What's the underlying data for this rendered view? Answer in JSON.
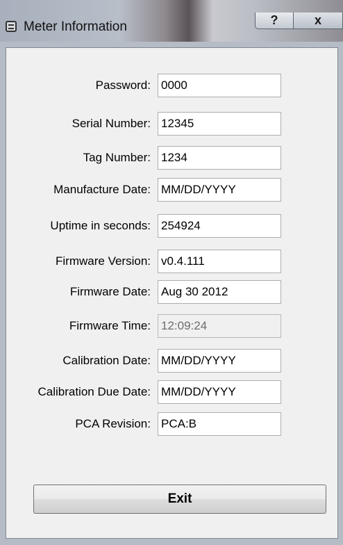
{
  "window": {
    "title": "Meter Information",
    "help_label": "?",
    "close_label": "x"
  },
  "fields": [
    {
      "label": "Password:",
      "value": "0000",
      "enabled": true
    },
    {
      "label": "Serial Number:",
      "value": "12345",
      "enabled": true
    },
    {
      "label": "Tag Number:",
      "value": "1234",
      "enabled": true
    },
    {
      "label": "Manufacture Date:",
      "value": "MM/DD/YYYY",
      "enabled": true
    },
    {
      "label": "Uptime in seconds:",
      "value": "254924",
      "enabled": true
    },
    {
      "label": "Firmware Version:",
      "value": "v0.4.111",
      "enabled": true
    },
    {
      "label": "Firmware Date:",
      "value": "Aug 30 2012",
      "enabled": true
    },
    {
      "label": "Firmware Time:",
      "value": "12:09:24",
      "enabled": false
    },
    {
      "label": "Calibration Date:",
      "value": "MM/DD/YYYY",
      "enabled": true
    },
    {
      "label": "Calibration Due Date:",
      "value": "MM/DD/YYYY",
      "enabled": true
    },
    {
      "label": "PCA Revision:",
      "value": "PCA:B",
      "enabled": true
    }
  ],
  "exit_label": "Exit"
}
